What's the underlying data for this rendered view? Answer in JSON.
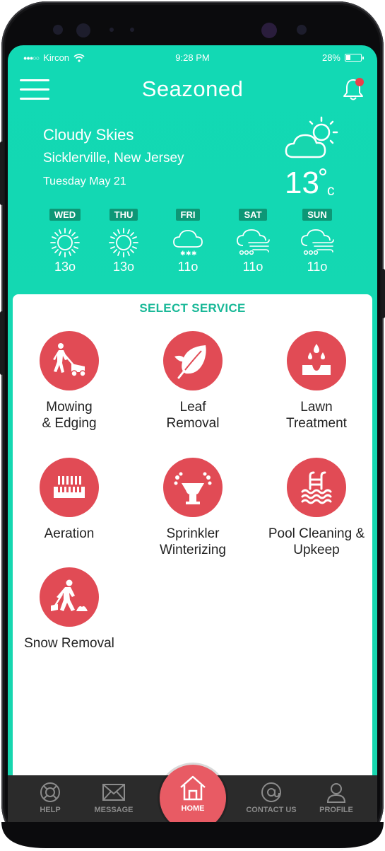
{
  "status_bar": {
    "carrier": "Kircon",
    "time": "9:28 PM",
    "battery_text": "28%",
    "battery_level": 0.28
  },
  "header": {
    "app_title": "Seazoned"
  },
  "weather": {
    "condition": "Cloudy Skies",
    "location": "Sicklerville, New Jersey",
    "date": "Tuesday May 21",
    "temperature": "13",
    "unit": "c",
    "icon": "partly-cloudy-icon"
  },
  "forecast": [
    {
      "day": "WED",
      "temp": "13o",
      "icon": "sun-icon"
    },
    {
      "day": "THU",
      "temp": "13o",
      "icon": "sun-icon"
    },
    {
      "day": "FRI",
      "temp": "11o",
      "icon": "snow-cloud-icon"
    },
    {
      "day": "SAT",
      "temp": "11o",
      "icon": "windy-cloud-icon"
    },
    {
      "day": "SUN",
      "temp": "11o",
      "icon": "windy-cloud-icon"
    }
  ],
  "services": {
    "title": "SELECT SERVICE",
    "items": [
      {
        "label": "Mowing\n& Edging",
        "icon": "mower-icon"
      },
      {
        "label": "Leaf\nRemoval",
        "icon": "leaf-icon"
      },
      {
        "label": "Lawn\nTreatment",
        "icon": "water-drops-icon"
      },
      {
        "label": "Aeration",
        "icon": "aeration-icon"
      },
      {
        "label": "Sprinkler\nWinterizing",
        "icon": "sprinkler-icon"
      },
      {
        "label": "Pool Cleaning &\nUpkeep",
        "icon": "pool-icon"
      },
      {
        "label": "Snow Removal",
        "icon": "shovel-icon"
      }
    ]
  },
  "bottom_nav": {
    "items": [
      {
        "label": "HELP",
        "icon": "lifebuoy-icon"
      },
      {
        "label": "MESSAGE",
        "icon": "envelope-icon"
      },
      {
        "label": "HOME",
        "icon": "home-icon",
        "active": true
      },
      {
        "label": "CONTACT US",
        "icon": "at-sign-icon"
      },
      {
        "label": "PROFILE",
        "icon": "user-icon"
      }
    ]
  },
  "colors": {
    "header_bg": "#14d7b1",
    "accent_red": "#e14b55",
    "title_green": "#18b897",
    "nav_bg": "#2b2b2b"
  }
}
